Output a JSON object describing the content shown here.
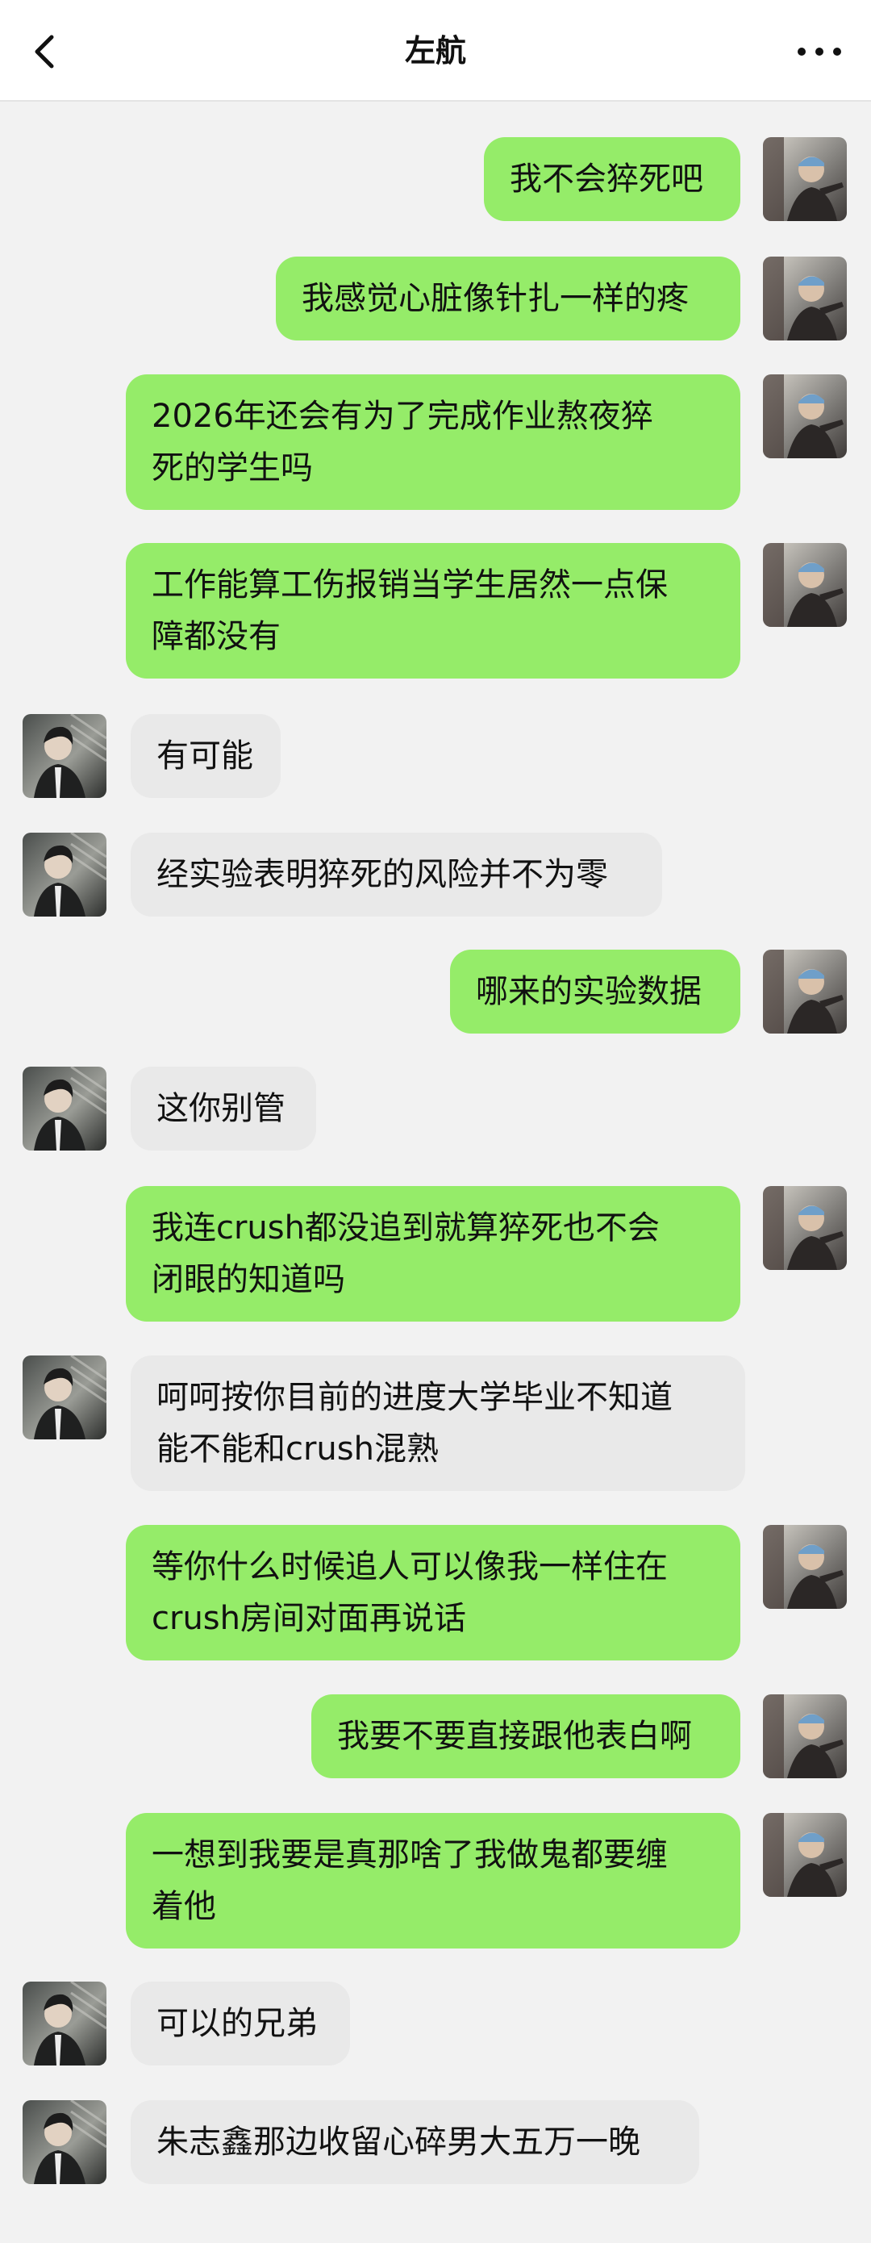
{
  "header": {
    "title": "左航",
    "back_icon": "chevron-left-icon",
    "more_icon": "more-horizontal-icon"
  },
  "colors": {
    "sent_bubble": "#95ec69",
    "received_bubble": "#e9e9e9",
    "background": "#f2f2f2"
  },
  "messages": [
    {
      "side": "right",
      "text": "我不会猝死吧"
    },
    {
      "side": "right",
      "text": "我感觉心脏像针扎一样的疼"
    },
    {
      "side": "right",
      "text": "2026年还会有为了完成作业熬夜猝\n死的学生吗"
    },
    {
      "side": "right",
      "text": "工作能算工伤报销当学生居然一点保\n障都没有"
    },
    {
      "side": "left",
      "text": "有可能"
    },
    {
      "side": "left",
      "text": "经实验表明猝死的风险并不为零"
    },
    {
      "side": "right",
      "text": "哪来的实验数据"
    },
    {
      "side": "left",
      "text": "这你别管"
    },
    {
      "side": "right",
      "text": "我连crush都没追到就算猝死也不会\n闭眼的知道吗"
    },
    {
      "side": "left",
      "text": "呵呵按你目前的进度大学毕业不知道\n能不能和crush混熟"
    },
    {
      "side": "right",
      "text": "等你什么时候追人可以像我一样住在\ncrush房间对面再说话"
    },
    {
      "side": "right",
      "text": "我要不要直接跟他表白啊"
    },
    {
      "side": "right",
      "text": "一想到我要是真那啥了我做鬼都要缠\n着他"
    },
    {
      "side": "left",
      "text": "可以的兄弟"
    },
    {
      "side": "left",
      "text": "朱志鑫那边收留心碎男大五万一晚"
    }
  ]
}
